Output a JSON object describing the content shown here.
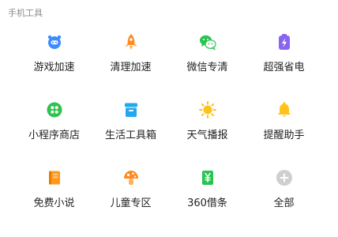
{
  "section": {
    "title": "手机工具"
  },
  "tools": [
    {
      "label": "游戏加速",
      "icon": "gamepad-icon",
      "color": "#3d8bff"
    },
    {
      "label": "清理加速",
      "icon": "rocket-icon",
      "color": "#ff8a1f"
    },
    {
      "label": "微信专清",
      "icon": "wechat-icon",
      "color": "#27c450"
    },
    {
      "label": "超强省电",
      "icon": "battery-icon",
      "color": "#8a63f0"
    },
    {
      "label": "小程序商店",
      "icon": "mini-program-icon",
      "color": "#2ec24f"
    },
    {
      "label": "生活工具箱",
      "icon": "toolbox-icon",
      "color": "#22a8ee"
    },
    {
      "label": "天气播报",
      "icon": "sun-icon",
      "color": "#ffc21a"
    },
    {
      "label": "提醒助手",
      "icon": "bell-icon",
      "color": "#ffc21a"
    },
    {
      "label": "免费小说",
      "icon": "book-icon",
      "color": "#ff9a1f"
    },
    {
      "label": "儿童专区",
      "icon": "mushroom-icon",
      "color": "#ff8a1f"
    },
    {
      "label": "360借条",
      "icon": "loan-note-icon",
      "color": "#27c450"
    },
    {
      "label": "全部",
      "icon": "plus-icon",
      "color": "#cfcfcf"
    }
  ]
}
